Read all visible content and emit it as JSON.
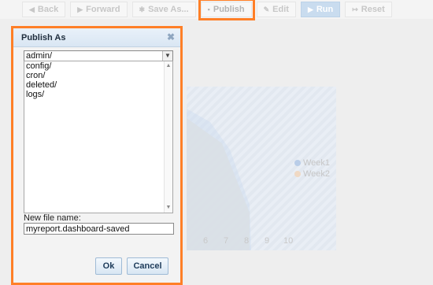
{
  "toolbar": {
    "buttons": [
      {
        "label": "Back",
        "icon": "arrow-left-icon"
      },
      {
        "label": "Forward",
        "icon": "arrow-right-icon"
      },
      {
        "label": "Save As...",
        "icon": "save-icon"
      },
      {
        "label": "Publish",
        "icon": "publish-icon"
      },
      {
        "label": "Edit",
        "icon": "edit-icon"
      },
      {
        "label": "Run",
        "icon": "play-icon"
      },
      {
        "label": "Reset",
        "icon": "reset-icon"
      }
    ]
  },
  "background_chart": {
    "legend": [
      {
        "name": "Week1",
        "color": "#b9cde8"
      },
      {
        "name": "Week2",
        "color": "#f0d9c4"
      }
    ],
    "x_ticks": [
      "6",
      "7",
      "8",
      "9",
      "10"
    ]
  },
  "dialog": {
    "title": "Publish As",
    "folder_selected": "admin/",
    "files": [
      "config/",
      "cron/",
      "deleted/",
      "logs/"
    ],
    "new_file_label": "New file name:",
    "new_file_value": "myreport.dashboard-saved",
    "ok_label": "Ok",
    "cancel_label": "Cancel"
  },
  "colors": {
    "highlight": "#ff7f27",
    "dialog_header": "#dce8f4"
  }
}
